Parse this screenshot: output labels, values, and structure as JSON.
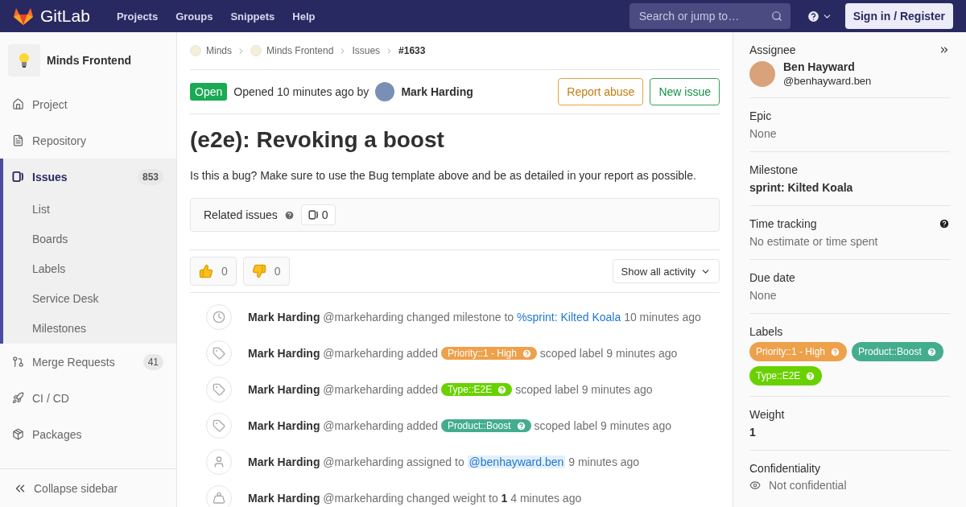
{
  "topbar": {
    "brand": "GitLab",
    "links": [
      "Projects",
      "Groups",
      "Snippets",
      "Help"
    ],
    "search": {
      "placeholder": "Search or jump to…"
    },
    "sign_in": "Sign in / Register"
  },
  "sidebar": {
    "project": "Minds Frontend",
    "items": [
      {
        "label": "Project",
        "kind": "project",
        "selected": false
      },
      {
        "label": "Repository",
        "kind": "repository",
        "selected": false
      },
      {
        "label": "Issues",
        "kind": "issues",
        "selected": true,
        "count": "853",
        "children": [
          {
            "label": "List",
            "selected": false
          },
          {
            "label": "Boards",
            "selected": false
          },
          {
            "label": "Labels",
            "selected": false
          },
          {
            "label": "Service Desk",
            "selected": false
          },
          {
            "label": "Milestones",
            "selected": false
          }
        ]
      },
      {
        "label": "Merge Requests",
        "kind": "merge",
        "selected": false,
        "count": "41"
      },
      {
        "label": "CI / CD",
        "kind": "rocket",
        "selected": false
      },
      {
        "label": "Packages",
        "kind": "package",
        "selected": false
      }
    ],
    "collapse": "Collapse sidebar"
  },
  "breadcrumbs": [
    {
      "label": "Minds",
      "avatar": true
    },
    {
      "label": "Minds Frontend",
      "avatar": true
    },
    {
      "label": "Issues",
      "avatar": false
    },
    {
      "label": "#1633",
      "avatar": false,
      "current": true
    }
  ],
  "issue": {
    "status": "Open",
    "opened": "Opened 10 minutes ago by",
    "author": "Mark Harding",
    "actions": [
      {
        "label": "Report abuse",
        "kind": "warning"
      },
      {
        "label": "New issue",
        "kind": "success"
      }
    ],
    "title": "(e2e): Revoking a boost",
    "description": "Is this a bug? Make sure to use the Bug template above and be as detailed in your report as possible.",
    "related": {
      "label": "Related issues",
      "count": "0"
    },
    "reactions": [
      {
        "kind": "up",
        "count": "0"
      },
      {
        "kind": "down",
        "count": "0"
      }
    ],
    "filter": "Show all activity",
    "activity": [
      {
        "kind": "milestone",
        "author": "Mark Harding",
        "handle": "@markeharding",
        "action": "changed milestone to",
        "link": "%sprint: Kilted Koala",
        "time": "10 minutes ago"
      },
      {
        "kind": "label",
        "author": "Mark Harding",
        "handle": "@markeharding",
        "action": "added",
        "label": {
          "text": "Priority::1 - High",
          "color": "#eda14b"
        },
        "after": "scoped label",
        "time": "9 minutes ago"
      },
      {
        "kind": "label",
        "author": "Mark Harding",
        "handle": "@markeharding",
        "action": "added",
        "label": {
          "text": "Type::E2E",
          "color": "#69d100"
        },
        "after": "scoped label",
        "time": "9 minutes ago"
      },
      {
        "kind": "label",
        "author": "Mark Harding",
        "handle": "@markeharding",
        "action": "added",
        "label": {
          "text": "Product::Boost",
          "color": "#44ad8e"
        },
        "after": "scoped label",
        "time": "9 minutes ago"
      },
      {
        "kind": "assign",
        "author": "Mark Harding",
        "handle": "@markeharding",
        "action": "assigned to",
        "mention": "@benhayward.ben",
        "time": "9 minutes ago"
      },
      {
        "kind": "weight",
        "author": "Mark Harding",
        "handle": "@markeharding",
        "action": "changed weight to",
        "value": "1",
        "time": "4 minutes ago"
      }
    ]
  },
  "right_sidebar": [
    {
      "kind": "assignee",
      "title": "Assignee",
      "name": "Ben Hayward",
      "handle": "@benhayward.ben"
    },
    {
      "kind": "muted",
      "title": "Epic",
      "value": "None"
    },
    {
      "kind": "strong",
      "title": "Milestone",
      "value": "sprint: Kilted Koala"
    },
    {
      "kind": "muted",
      "title": "Time tracking",
      "value": "No estimate or time spent",
      "help": true
    },
    {
      "kind": "muted",
      "title": "Due date",
      "value": "None"
    },
    {
      "kind": "labels",
      "title": "Labels",
      "labels": [
        {
          "text": "Priority::1 - High",
          "color": "#eda14b"
        },
        {
          "text": "Product::Boost",
          "color": "#44ad8e"
        },
        {
          "text": "Type::E2E",
          "color": "#69d100"
        }
      ]
    },
    {
      "kind": "strong",
      "title": "Weight",
      "value": "1"
    },
    {
      "kind": "confidential",
      "title": "Confidentiality",
      "value": "Not confidential"
    }
  ]
}
